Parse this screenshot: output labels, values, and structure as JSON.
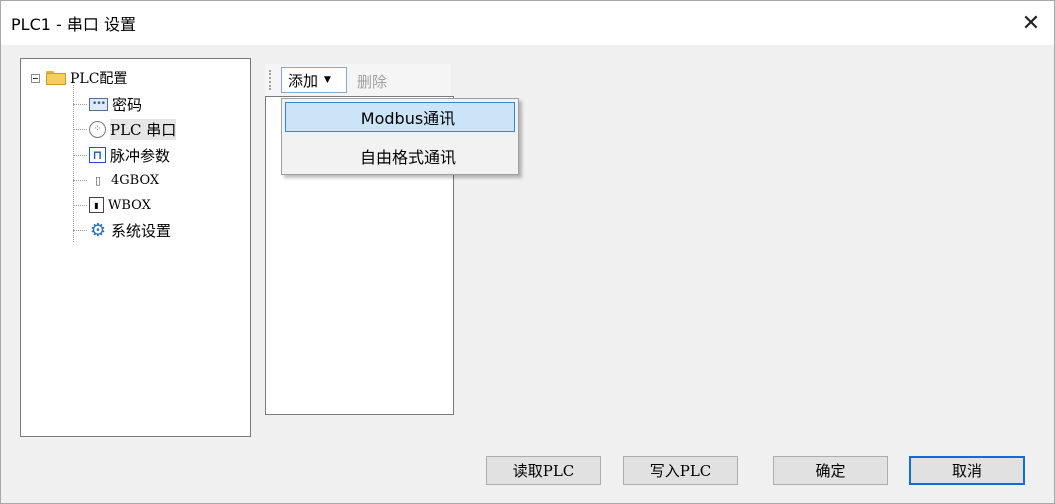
{
  "window": {
    "title": "PLC1 - 串口 设置",
    "close_label": "✕"
  },
  "tree": {
    "root_label": "PLC配置",
    "items": [
      {
        "label": "密码",
        "icon": "password-icon"
      },
      {
        "label": "PLC 串口",
        "icon": "serial-port-icon"
      },
      {
        "label": "脉冲参数",
        "icon": "pulse-icon"
      },
      {
        "label": "4GBOX",
        "icon": "4gbox-icon"
      },
      {
        "label": "WBOX",
        "icon": "wbox-icon"
      },
      {
        "label": "系统设置",
        "icon": "gear-icon"
      }
    ],
    "selected_index": 1
  },
  "toolbar": {
    "add_label": "添加",
    "delete_label": "删除"
  },
  "add_menu": {
    "items": [
      {
        "label": "Modbus通讯"
      },
      {
        "label": "自由格式通讯"
      }
    ],
    "hovered_index": 0
  },
  "buttons": {
    "read_plc": "读取PLC",
    "write_plc": "写入PLC",
    "ok": "确定",
    "cancel": "取消"
  }
}
